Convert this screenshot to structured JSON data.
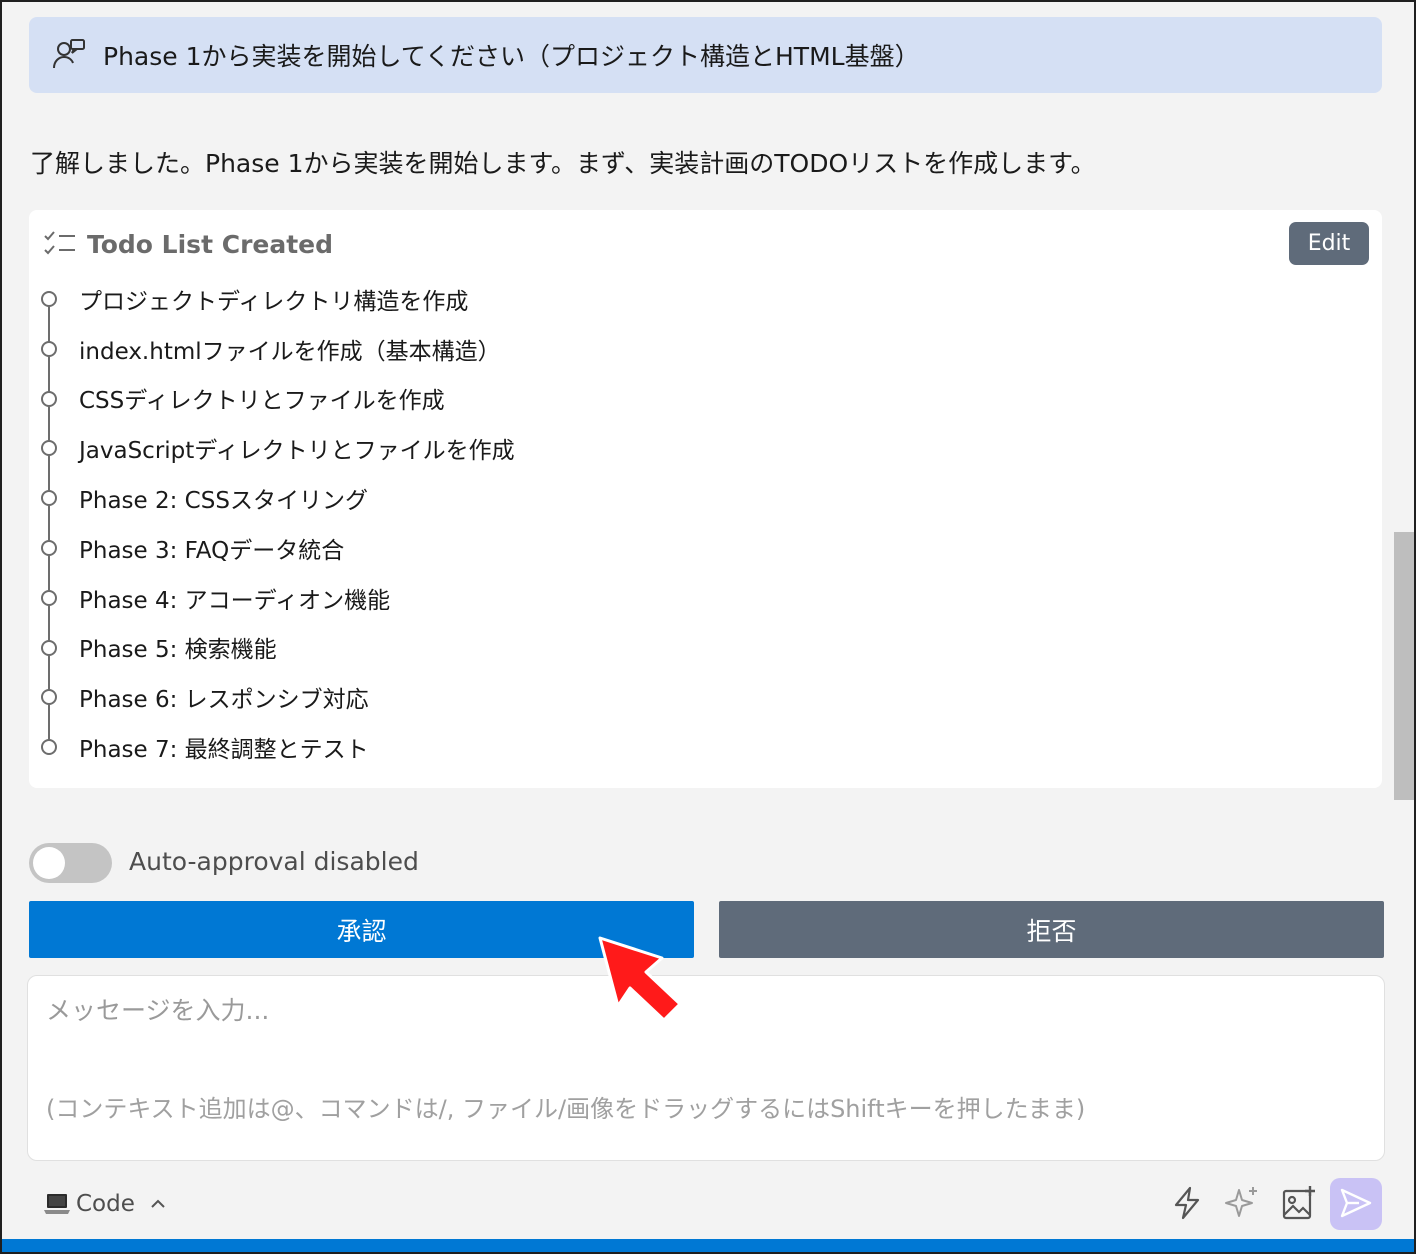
{
  "user_message": {
    "text": "Phase 1から実装を開始してください（プロジェクト構造とHTML基盤）"
  },
  "assistant_reply": {
    "text": "了解しました。Phase 1から実装を開始します。まず、実装計画のTODOリストを作成します。"
  },
  "todo": {
    "title": "Todo List Created",
    "edit_label": "Edit",
    "items": [
      "プロジェクトディレクトリ構造を作成",
      "index.htmlファイルを作成（基本構造）",
      "CSSディレクトリとファイルを作成",
      "JavaScriptディレクトリとファイルを作成",
      "Phase 2: CSSスタイリング",
      "Phase 3: FAQデータ統合",
      "Phase 4: アコーディオン機能",
      "Phase 5: 検索機能",
      "Phase 6: レスポンシブ対応",
      "Phase 7: 最終調整とテスト"
    ]
  },
  "auto_approval": {
    "label": "Auto-approval disabled",
    "enabled": false
  },
  "actions": {
    "approve_label": "承認",
    "reject_label": "拒否"
  },
  "composer": {
    "placeholder": "メッセージを入力...",
    "hint": "(コンテキスト追加は@、コマンドは/, ファイル/画像をドラッグするにはShiftキーを押したまま)",
    "mode_label": "Code"
  },
  "icons": {
    "user": "user-feedback-icon",
    "todo": "checklist-icon",
    "laptop": "laptop-icon",
    "chevron": "chevron-up-icon",
    "bolt": "bolt-icon",
    "sparkle": "sparkle-icon",
    "image": "image-add-icon",
    "send": "send-icon"
  },
  "colors": {
    "accent": "#0078d4",
    "secondary_button": "#5f6b7a",
    "user_bubble": "#d5e0f4",
    "send_button": "#c9c2f5"
  }
}
